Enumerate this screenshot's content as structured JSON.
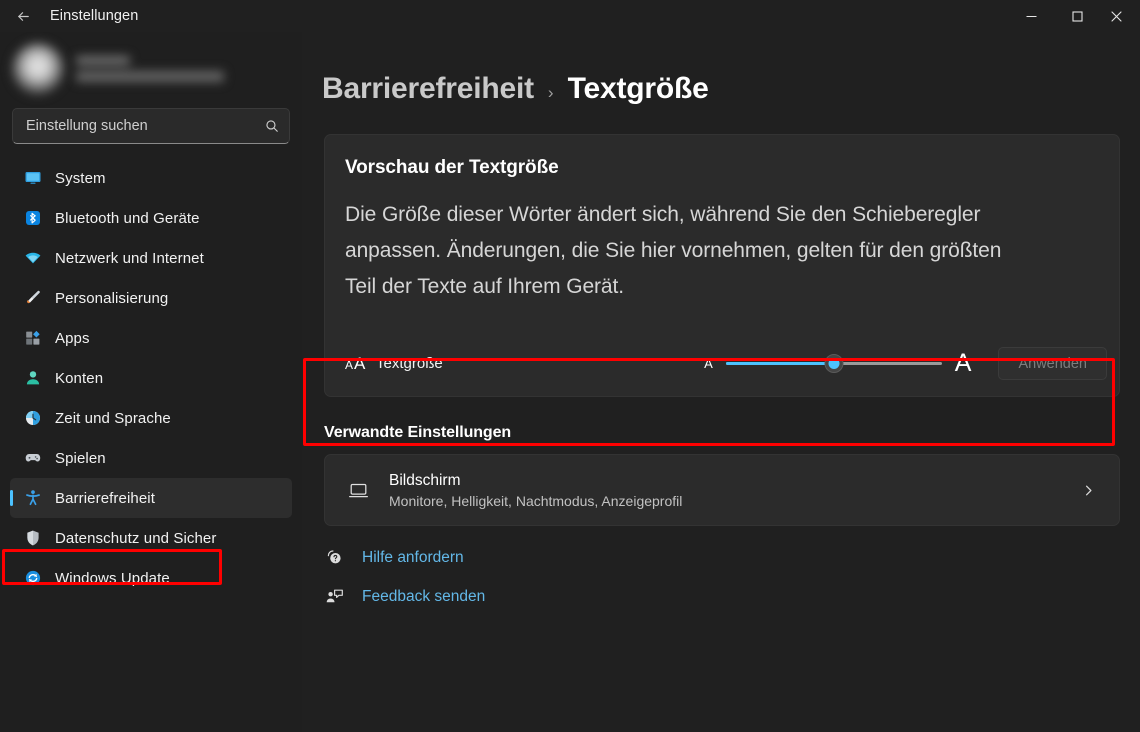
{
  "window": {
    "title": "Einstellungen",
    "back_icon": "back-arrow-icon",
    "minimize_label": "Minimieren",
    "maximize_label": "Maximieren",
    "close_label": "Schließen"
  },
  "sidebar": {
    "profile": {
      "redacted": true,
      "avatar_icon": "user-avatar"
    },
    "search": {
      "placeholder": "Einstellung suchen",
      "value": "",
      "icon": "search-icon"
    },
    "items": [
      {
        "label": "System",
        "icon": "monitor-icon",
        "selected": false
      },
      {
        "label": "Bluetooth und Geräte",
        "icon": "bluetooth-icon",
        "selected": false
      },
      {
        "label": "Netzwerk und Internet",
        "icon": "wifi-icon",
        "selected": false
      },
      {
        "label": "Personalisierung",
        "icon": "paintbrush-icon",
        "selected": false
      },
      {
        "label": "Apps",
        "icon": "apps-icon",
        "selected": false
      },
      {
        "label": "Konten",
        "icon": "account-icon",
        "selected": false
      },
      {
        "label": "Zeit und Sprache",
        "icon": "clock-icon",
        "selected": false
      },
      {
        "label": "Spielen",
        "icon": "gamepad-icon",
        "selected": false
      },
      {
        "label": "Barrierefreiheit",
        "icon": "accessibility-icon",
        "selected": true
      },
      {
        "label": "Datenschutz und Sicher",
        "icon": "shield-icon",
        "selected": false
      },
      {
        "label": "Windows Update",
        "icon": "update-icon",
        "selected": false
      }
    ]
  },
  "breadcrumb": {
    "parent": "Barrierefreiheit",
    "separator": "›",
    "current": "Textgröße"
  },
  "main": {
    "preview": {
      "title": "Vorschau der Textgröße",
      "text": "Die Größe dieser Wörter ändert sich, während Sie den Schieberegler anpassen. Änderungen, die Sie hier vornehmen, gelten für den größten Teil der Texte auf Ihrem Gerät."
    },
    "text_size_row": {
      "icon": "text-size-icon",
      "label": "Textgröße",
      "min_label": "A",
      "max_label": "A",
      "slider_value": 50,
      "slider_min": 0,
      "slider_max": 100,
      "apply_label": "Anwenden",
      "apply_disabled": true
    },
    "related_section_title": "Verwandte Einstellungen",
    "related_card": {
      "icon": "display-icon",
      "title": "Bildschirm",
      "subtitle": "Monitore, Helligkeit, Nachtmodus, Anzeigeprofil",
      "chevron": "chevron-right-icon"
    },
    "help_links": [
      {
        "label": "Hilfe anfordern",
        "icon": "help-icon"
      },
      {
        "label": "Feedback senden",
        "icon": "feedback-icon"
      }
    ]
  },
  "annotations": {
    "highlight_color": "#ff0000",
    "nav_highlight_target": "Barrierefreiheit",
    "slider_highlight_target": "Textgröße"
  },
  "colors": {
    "accent": "#4cc2ff",
    "link": "#63b8e8",
    "page_background": "#202020",
    "sidebar_background": "#1f1f1f",
    "card_background": "#2b2b2b"
  }
}
